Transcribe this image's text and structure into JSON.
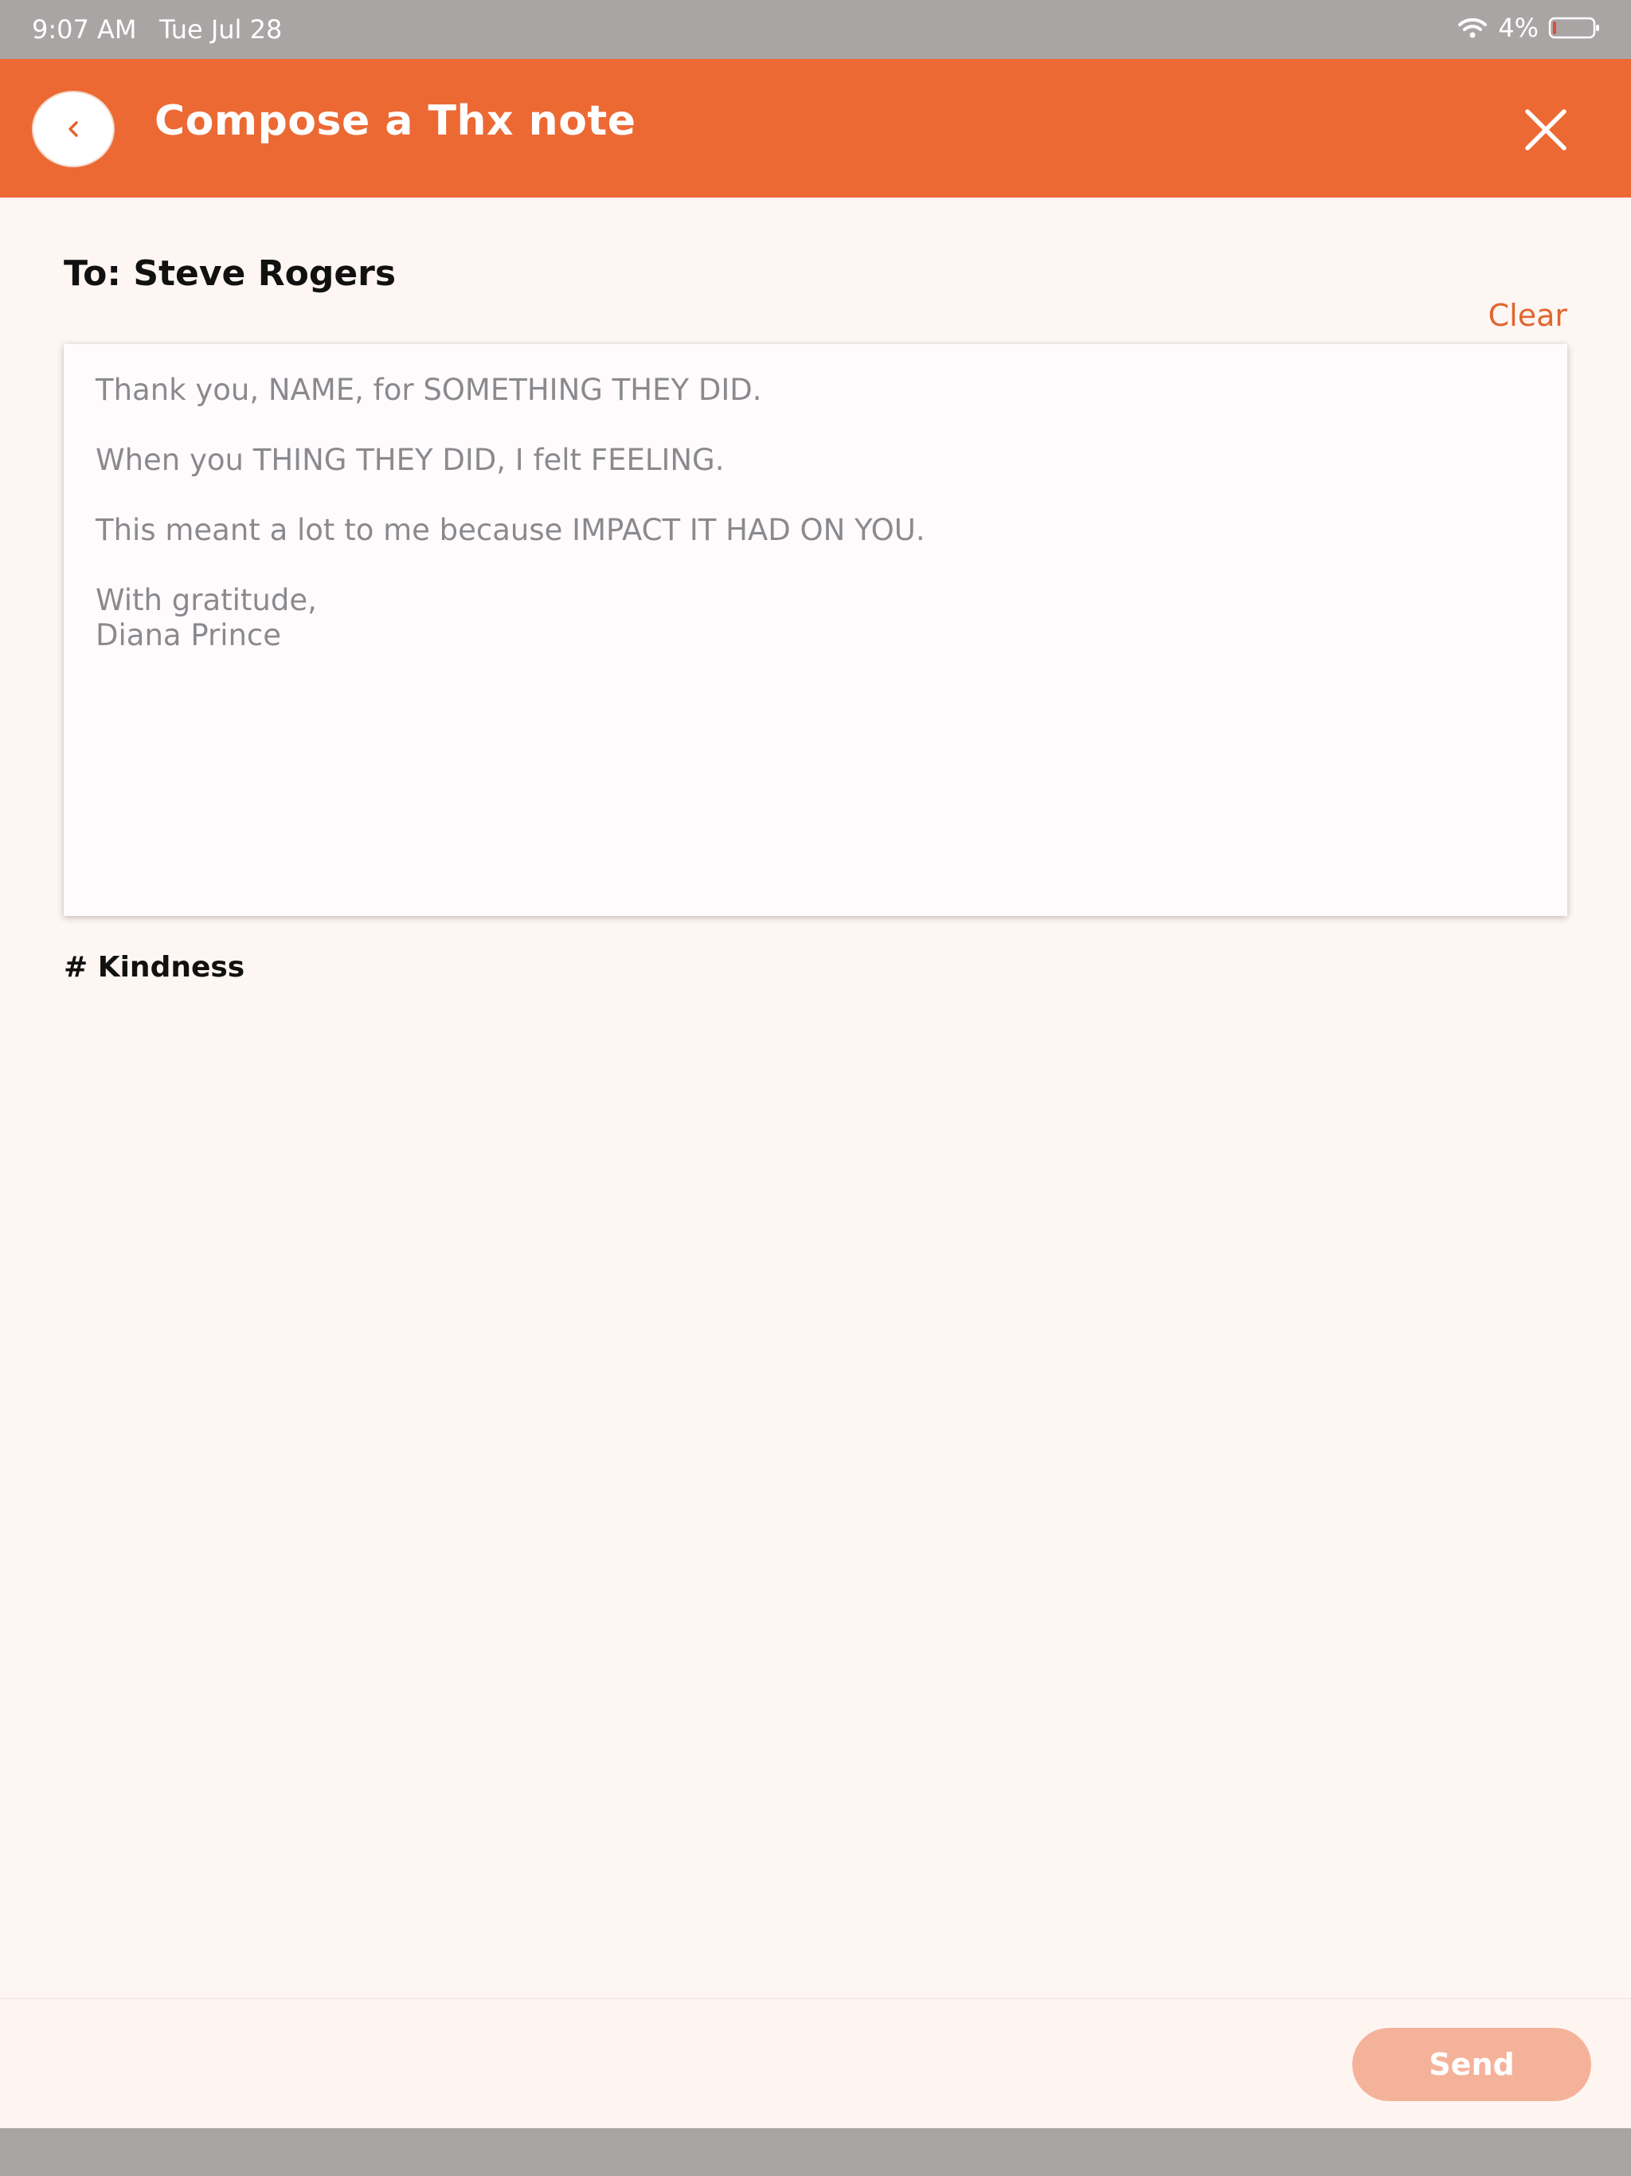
{
  "status_bar": {
    "time": "9:07 AM",
    "date": "Tue Jul 28",
    "battery_percent": "4%",
    "wifi_icon": "wifi-icon",
    "battery_icon": "battery-low-icon"
  },
  "header": {
    "title": "Compose a Thx note",
    "back_icon": "chevron-left-icon",
    "close_icon": "close-icon",
    "color": "#ec6934"
  },
  "compose": {
    "to_label": "To: Steve Rogers",
    "clear_label": "Clear",
    "note_lines": [
      "Thank you, NAME, for SOMETHING THEY DID.",
      "When you THING THEY DID, I felt FEELING.",
      "This meant a lot to me because IMPACT IT HAD ON YOU.",
      "With gratitude,",
      "Diana Prince"
    ],
    "tag": "# Kindness"
  },
  "footer": {
    "send_label": "Send",
    "send_color": "#f5b29a"
  }
}
